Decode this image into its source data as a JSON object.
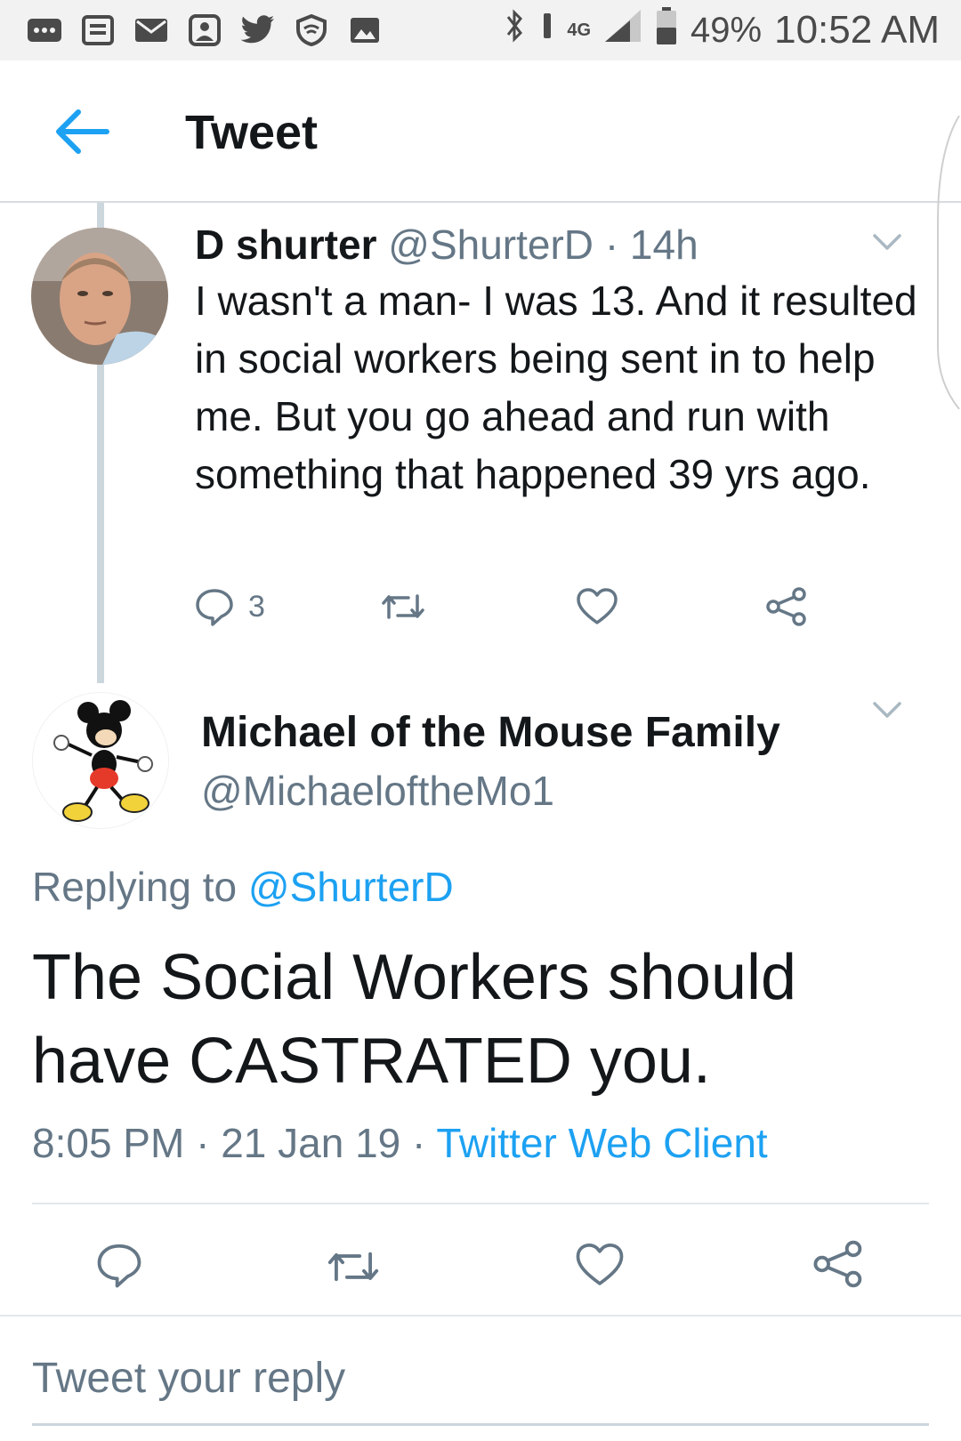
{
  "status_bar": {
    "network": "4G",
    "battery": "49%",
    "time": "10:52 AM"
  },
  "app_bar": {
    "title": "Tweet",
    "back_icon": "arrow-left-icon"
  },
  "parent_tweet": {
    "name": "D shurter",
    "handle": "@ShurterD",
    "separator": "·",
    "time": "14h",
    "text": "I wasn't a man- I was 13. And it resulted in social workers being sent in to help me. But you go ahead and run with something that happened 39 yrs ago.",
    "reply_count": "3"
  },
  "main_tweet": {
    "name": "Michael of the Mouse Family",
    "handle": "@MichaeloftheMo1",
    "replying_label": "Replying to",
    "replying_to": "@ShurterD",
    "text": "The Social Workers should have CASTRATED you.",
    "time": "8:05 PM",
    "separator": "·",
    "date": "21 Jan 19",
    "client": "Twitter Web Client"
  },
  "reply_box": {
    "placeholder": "Tweet your reply"
  },
  "colors": {
    "accent": "#1da1f2",
    "muted": "#657786",
    "text": "#14171a"
  }
}
